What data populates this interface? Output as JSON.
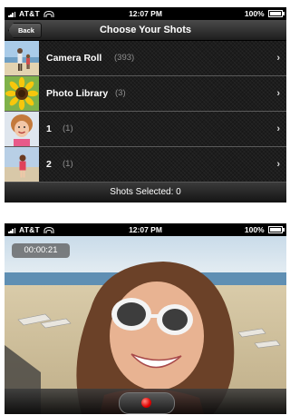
{
  "top_screen": {
    "status": {
      "carrier": "AT&T",
      "time": "12:07 PM",
      "battery": "100%"
    },
    "nav": {
      "back_label": "Back",
      "title": "Choose Your Shots"
    },
    "albums": [
      {
        "label": "Camera Roll",
        "count": "(393)"
      },
      {
        "label": "Photo Library",
        "count": "(3)"
      },
      {
        "label": "1",
        "count": "(1)"
      },
      {
        "label": "2",
        "count": "(1)"
      }
    ],
    "footer": "Shots Selected: 0"
  },
  "bottom_screen": {
    "status": {
      "carrier": "AT&T",
      "time": "12:07 PM",
      "battery": "100%"
    },
    "timer": "00:00:21"
  },
  "icons": {
    "back": "back-chevron-icon",
    "disclosure": "chevron-right-icon",
    "record": "record-icon",
    "signal": "signal-icon",
    "wifi": "wifi-icon",
    "battery": "battery-icon"
  },
  "colors": {
    "record_red": "#e00000",
    "row_count_gray": "#8f8f8f"
  }
}
